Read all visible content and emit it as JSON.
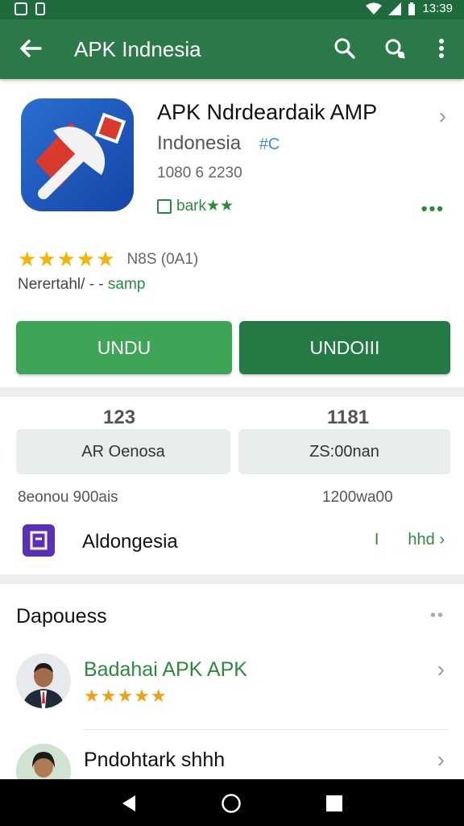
{
  "status_bar": {
    "time": "13:39"
  },
  "app_bar": {
    "title": "APK Indnesia"
  },
  "app": {
    "name": "APK Ndrdeardaik AMP",
    "publisher": "Indonesia",
    "publisher_tag": "#C",
    "numbers": "1080 6 2230",
    "badge": "bark★★"
  },
  "rating": {
    "stars": "★★★★★",
    "text": "N8S (0A1)"
  },
  "meta": {
    "prefix": "Nerertahl/ - -",
    "link": "samp"
  },
  "buttons": {
    "primary": "UNDU",
    "secondary": "UNDOIII"
  },
  "stats": [
    {
      "number": "123",
      "box": "AR Oenosa",
      "caption": "8eonou 900ais"
    },
    {
      "number": "1181",
      "box": "ZS:00nan",
      "caption": "1200wa00"
    }
  ],
  "developer": {
    "name": "Aldongesia",
    "right_a": "I",
    "right_b": "hhd"
  },
  "section": {
    "title": "Dapouess"
  },
  "list": [
    {
      "title": "Badahai APK APK",
      "stars": "★★★★★",
      "title_color": "#2c8a3e"
    },
    {
      "title": "Pndohtark shhh",
      "stars": "",
      "title_color": "#111111"
    }
  ],
  "colors": {
    "status_bar": "#1e6b3d",
    "app_bar": "#2c7a4a",
    "button_primary": "#3ea556",
    "button_secondary": "#237a45",
    "accent": "#2c8a3e",
    "star": "#f5b400"
  },
  "icons": [
    "back-arrow-icon",
    "search-icon",
    "voice-search-icon",
    "overflow-menu-icon",
    "chevron-right-icon",
    "more-dots-icon",
    "badge-icon",
    "developer-icon",
    "nav-back-icon",
    "nav-home-icon",
    "nav-recents-icon"
  ]
}
